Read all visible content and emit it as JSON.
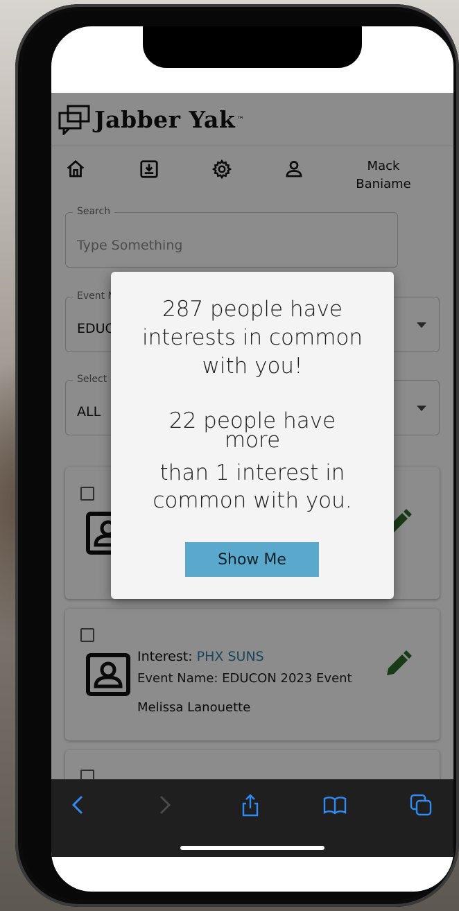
{
  "app": {
    "logo_text": "Jabber Yak",
    "logo_tm": "™"
  },
  "nav": {
    "user_first": "Mack",
    "user_last": "Baniame"
  },
  "search": {
    "label": "Search",
    "placeholder": "Type Something"
  },
  "event_select": {
    "label": "Event N",
    "value": "EDUC"
  },
  "interest_select": {
    "label": "Select I",
    "value": "ALL"
  },
  "cards": [
    {
      "interest_label": "Interest:",
      "interest_value": "PHX SUNS",
      "event": "Event Name: EDUCON 2023 Event",
      "person": "Melissa Lanouette"
    }
  ],
  "modal": {
    "line1": "287 people have",
    "line2": "interests in common",
    "line3": "with you!",
    "line4": "22 people have",
    "line5": "more",
    "line6": "than 1 interest in",
    "line7": "common with you.",
    "button": "Show Me"
  },
  "colors": {
    "accent_blue": "#5aa9cd",
    "edit_green": "#2e6b2a",
    "link_blue": "#2c7fa6",
    "ios_blue": "#2f8cf6"
  }
}
